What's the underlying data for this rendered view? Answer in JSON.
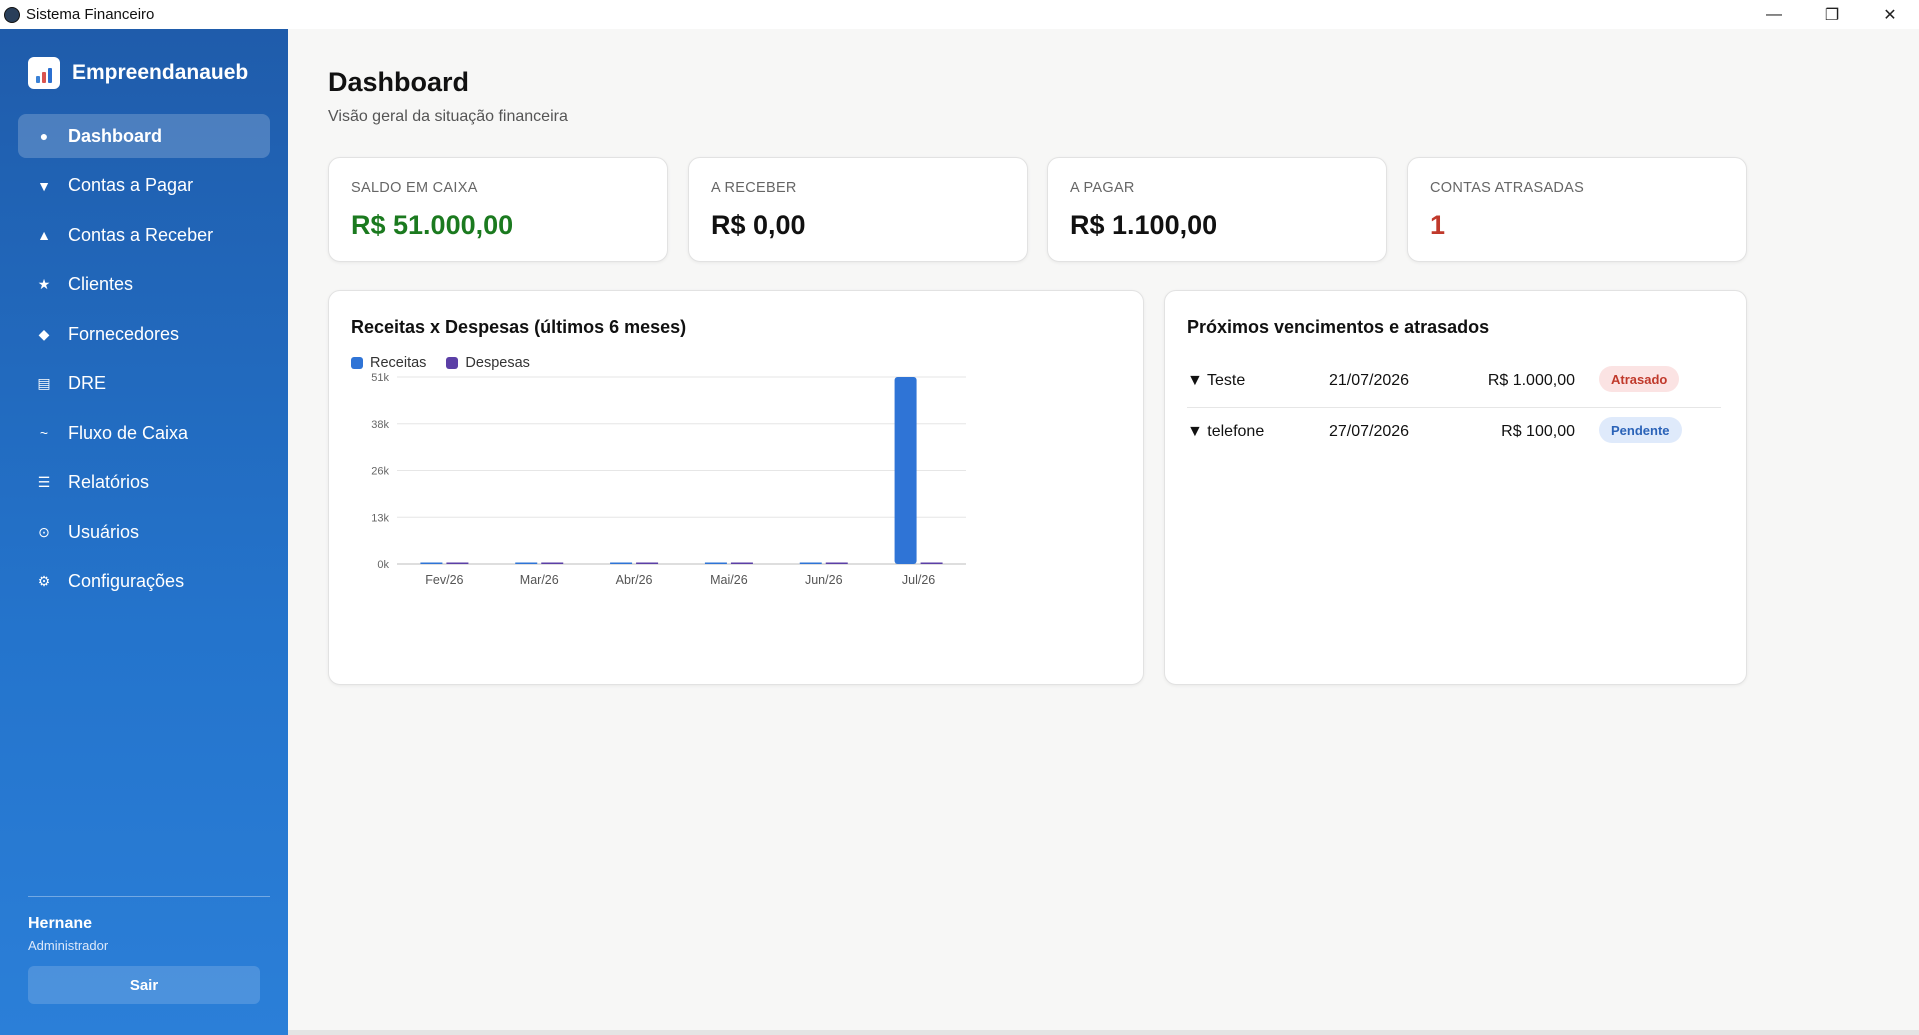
{
  "window": {
    "title": "Sistema Financeiro",
    "minimize": "—",
    "maximize": "❐",
    "close": "✕"
  },
  "sidebar": {
    "brand": "Empreendanaueb",
    "items": [
      {
        "label": "Dashboard",
        "icon": "●",
        "icon_name": "dot-icon",
        "active": true
      },
      {
        "label": "Contas a Pagar",
        "icon": "▼",
        "icon_name": "down-triangle-icon"
      },
      {
        "label": "Contas a Receber",
        "icon": "▲",
        "icon_name": "up-triangle-icon"
      },
      {
        "label": "Clientes",
        "icon": "★",
        "icon_name": "star-icon"
      },
      {
        "label": "Fornecedores",
        "icon": "◆",
        "icon_name": "diamond-icon"
      },
      {
        "label": "DRE",
        "icon": "▤",
        "icon_name": "list-icon"
      },
      {
        "label": "Fluxo de Caixa",
        "icon": "~",
        "icon_name": "wave-icon"
      },
      {
        "label": "Relatórios",
        "icon": "☰",
        "icon_name": "menu-icon"
      },
      {
        "label": "Usuários",
        "icon": "⊙",
        "icon_name": "user-circle-icon"
      },
      {
        "label": "Configurações",
        "icon": "⚙",
        "icon_name": "gear-icon"
      }
    ],
    "user": {
      "name": "Hernane",
      "role": "Administrador"
    },
    "logout_label": "Sair"
  },
  "header": {
    "title": "Dashboard",
    "subtitle": "Visão geral da situação financeira"
  },
  "stats": [
    {
      "label": "SALDO EM CAIXA",
      "value": "R$ 51.000,00",
      "color": "#1b7a1f"
    },
    {
      "label": "A RECEBER",
      "value": "R$ 0,00",
      "color": "#111111"
    },
    {
      "label": "A PAGAR",
      "value": "R$ 1.100,00",
      "color": "#111111"
    },
    {
      "label": "CONTAS ATRASADAS",
      "value": "1",
      "color": "#c0392b"
    }
  ],
  "chart_card": {
    "title": "Receitas x Despesas (últimos 6 meses)"
  },
  "chart_data": {
    "type": "bar",
    "title": "Receitas x Despesas (últimos 6 meses)",
    "categories": [
      "Fev/26",
      "Mar/26",
      "Abr/26",
      "Mai/26",
      "Jun/26",
      "Jul/26"
    ],
    "series": [
      {
        "name": "Receitas",
        "color": "#2f74d6",
        "values": [
          0,
          0,
          0,
          0,
          0,
          51000
        ]
      },
      {
        "name": "Despesas",
        "color": "#5b3fa6",
        "values": [
          0,
          0,
          0,
          0,
          0,
          0
        ]
      }
    ],
    "yticks": [
      "0k",
      "13k",
      "26k",
      "38k",
      "51k"
    ],
    "ylim": [
      0,
      51000
    ],
    "grid": true,
    "legend": "top-left"
  },
  "due_card": {
    "title": "Próximos vencimentos e atrasados",
    "rows": [
      {
        "name": "▼ Teste",
        "date": "21/07/2026",
        "amount": "R$ 1.000,00",
        "status": "Atrasado",
        "status_bg": "#fbe3e3",
        "status_fg": "#c0392b"
      },
      {
        "name": "▼ telefone",
        "date": "27/07/2026",
        "amount": "R$ 100,00",
        "status": "Pendente",
        "status_bg": "#dfeafb",
        "status_fg": "#2b63b8"
      }
    ]
  }
}
